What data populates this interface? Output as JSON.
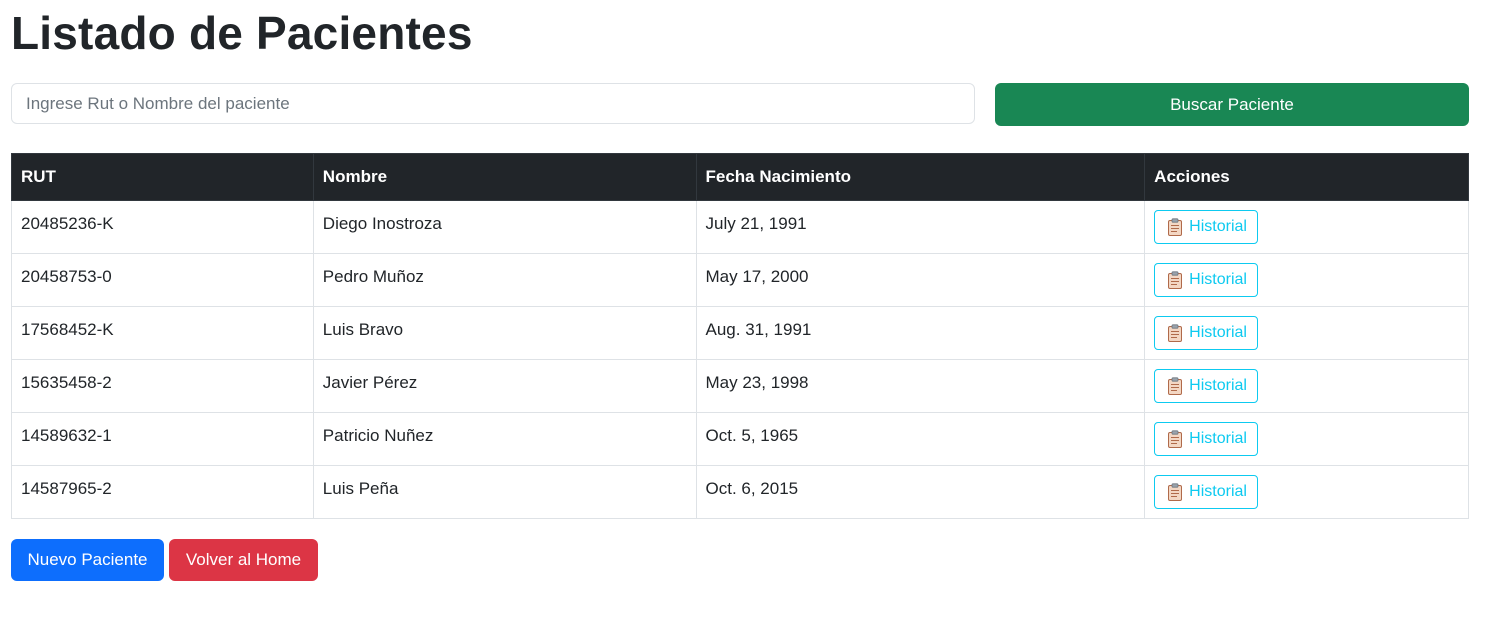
{
  "page": {
    "title": "Listado de Pacientes"
  },
  "search": {
    "placeholder": "Ingrese Rut o Nombre del paciente",
    "value": "",
    "button_label": "Buscar Paciente"
  },
  "table": {
    "headers": [
      "RUT",
      "Nombre",
      "Fecha Nacimiento",
      "Acciones"
    ],
    "rows": [
      {
        "rut": "20485236-K",
        "nombre": "Diego Inostroza",
        "fecha": "July 21, 1991",
        "accion": "Historial"
      },
      {
        "rut": "20458753-0",
        "nombre": "Pedro Muñoz",
        "fecha": "May 17, 2000",
        "accion": "Historial"
      },
      {
        "rut": "17568452-K",
        "nombre": "Luis Bravo",
        "fecha": "Aug. 31, 1991",
        "accion": "Historial"
      },
      {
        "rut": "15635458-2",
        "nombre": "Javier Pérez",
        "fecha": "May 23, 1998",
        "accion": "Historial"
      },
      {
        "rut": "14589632-1",
        "nombre": "Patricio Nuñez",
        "fecha": "Oct. 5, 1965",
        "accion": "Historial"
      },
      {
        "rut": "14587965-2",
        "nombre": "Luis Peña",
        "fecha": "Oct. 6, 2015",
        "accion": "Historial"
      }
    ],
    "action_icon": "clipboard-icon"
  },
  "footer": {
    "new_patient_label": "Nuevo Paciente",
    "home_label": "Volver al Home"
  },
  "colors": {
    "search_button": "#198754",
    "header_bg": "#212529",
    "historial": "#0dcaf0",
    "primary": "#0d6efd",
    "danger": "#dc3545"
  }
}
